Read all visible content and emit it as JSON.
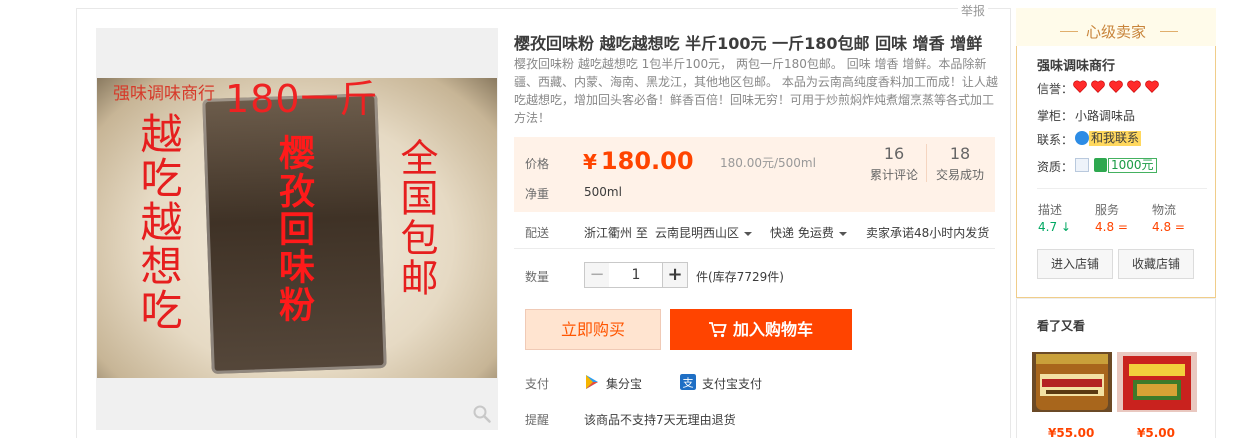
{
  "report_link": "举报",
  "photo": {
    "store_text": "强味调味商行",
    "price_text": "180一斤",
    "left_text": "越吃越想吃",
    "mid_text": "樱孜回味粉",
    "right_text": "全国包邮"
  },
  "product": {
    "title": "樱孜回味粉 越吃越想吃 半斤100元 一斤180包邮 回味 增香 增鲜",
    "description": "樱孜回味粉 越吃越想吃 1包半斤100元， 两包一斤180包邮。 回味 增香 增鲜。本品除新疆、西藏、内蒙、海南、黑龙江，其他地区包邮。 本品为云南高纯度香料加工而成！让人越吃越想吃，增加回头客必备！鲜香百倍！回味无穷！可用于炒煎焖炸炖煮熘烹蒸等各式加工方法！"
  },
  "price": {
    "label": "价格",
    "currency": "¥",
    "amount": "180.00",
    "unit_price": "180.00元/500ml",
    "net_label": "净重",
    "net_value": "500ml",
    "reviews_count": "16",
    "reviews_label": "累计评论",
    "deals_count": "18",
    "deals_label": "交易成功"
  },
  "delivery": {
    "label": "配送",
    "from": "浙江衢州 至",
    "to": "云南昆明西山区",
    "method": "快递 免运费",
    "promise": "卖家承诺48小时内发货"
  },
  "quantity": {
    "label": "数量",
    "value": "1",
    "minus": "−",
    "plus": "+",
    "stock": "件(库存7729件)"
  },
  "actions": {
    "buy_now": "立即购买",
    "add_to_cart": "加入购物车"
  },
  "payment": {
    "label": "支付",
    "option1": "集分宝",
    "option2": "支付宝支付"
  },
  "reminder": {
    "label": "提醒",
    "text": "该商品不支持7天无理由退货"
  },
  "seller": {
    "header": "心级卖家",
    "shop_name": "强味调味商行",
    "credit_label": "信誉：",
    "credit_hearts": 5,
    "owner_label": "掌柜：",
    "owner_name": "小路调味品",
    "contact_label": "联系：",
    "contact_text": "和我联系",
    "qual_label": "资质：",
    "deposit": "1000元",
    "scores": [
      {
        "label": "描述",
        "value": "4.7",
        "trend": "down",
        "color": "#00a862"
      },
      {
        "label": "服务",
        "value": "4.8",
        "trend": "equal",
        "color": "#ff4400"
      },
      {
        "label": "物流",
        "value": "4.8",
        "trend": "equal",
        "color": "#ff4400"
      }
    ],
    "enter_shop": "进入店铺",
    "favorite_shop": "收藏店铺"
  },
  "also_viewed": {
    "title": "看了又看",
    "items": [
      {
        "price": "¥55.00"
      },
      {
        "price": "¥5.00"
      }
    ]
  },
  "colors": {
    "accent": "#ff4400",
    "price_bg": "#fff2e8",
    "seller_border": "#f0cd8a"
  }
}
